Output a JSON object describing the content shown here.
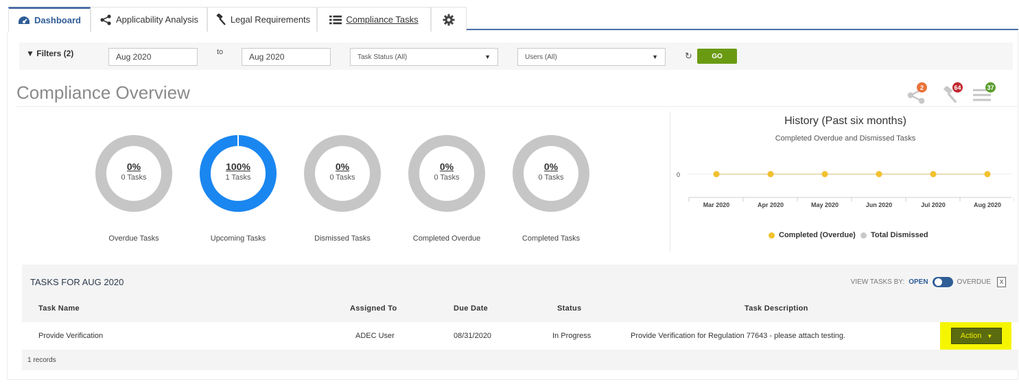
{
  "tabs": [
    {
      "label": "Dashboard",
      "icon": "dashboard-icon",
      "active": true
    },
    {
      "label": "Applicability Analysis",
      "icon": "share-icon"
    },
    {
      "label": "Legal Requirements",
      "icon": "gavel-icon"
    },
    {
      "label": "Compliance Tasks",
      "icon": "list-icon"
    },
    {
      "label": "",
      "icon": "gear-icon"
    }
  ],
  "filters": {
    "label": "Filters (2)",
    "from_value": "Aug 2020",
    "to_label": "to",
    "to_value": "Aug 2020",
    "status_select": "Task Status (All)",
    "users_select": "Users (All)",
    "go_label": "GO"
  },
  "overview": {
    "title": "Compliance Overview",
    "badges": [
      {
        "icon": "share-icon",
        "count": "2",
        "color": "#e8743b"
      },
      {
        "icon": "gavel-icon",
        "count": "64",
        "color": "#c0272d"
      },
      {
        "icon": "list-icon",
        "count": "37",
        "color": "#5a9e2f"
      }
    ]
  },
  "donuts": [
    {
      "pct": "0%",
      "tasks": "0 Tasks",
      "caption": "Overdue Tasks",
      "fill": 0
    },
    {
      "pct": "100%",
      "tasks": "1 Tasks",
      "caption": "Upcoming Tasks",
      "fill": 1
    },
    {
      "pct": "0%",
      "tasks": "0 Tasks",
      "caption": "Dismissed Tasks",
      "fill": 0
    },
    {
      "pct": "0%",
      "tasks": "0 Tasks",
      "caption": "Completed Overdue",
      "fill": 0
    },
    {
      "pct": "0%",
      "tasks": "0 Tasks",
      "caption": "Completed Tasks",
      "fill": 0
    }
  ],
  "chart_data": {
    "type": "line",
    "title": "History (Past six months)",
    "subtitle": "Completed Overdue and Dismissed Tasks",
    "categories": [
      "Mar 2020",
      "Apr 2020",
      "May 2020",
      "Jun 2020",
      "Jul 2020",
      "Aug 2020"
    ],
    "series": [
      {
        "name": "Completed (Overdue)",
        "values": [
          0,
          0,
          0,
          0,
          0,
          0
        ],
        "color": "#f2c12e"
      },
      {
        "name": "Total Dismissed",
        "values": [
          0,
          0,
          0,
          0,
          0,
          0
        ],
        "color": "#c8c8c8"
      }
    ],
    "yticks": [
      "0"
    ],
    "legend_position": "bottom"
  },
  "tasks": {
    "title": "TASKS FOR AUG 2020",
    "viewby_label": "VIEW TASKS BY:",
    "viewby_open": "OPEN",
    "viewby_overdue": "OVERDUE",
    "headers": [
      "Task Name",
      "Assigned To",
      "Due Date",
      "Status",
      "Task Description"
    ],
    "rows": [
      {
        "name": "Provide Verification",
        "assigned": "ADEC User",
        "due": "08/31/2020",
        "status": "In Progress",
        "description": "Provide Verification for Regulation 77643 - please attach testing.",
        "action_label": "Action"
      }
    ],
    "records": "1 records"
  },
  "colors": {
    "accent": "#4a6fa5",
    "go": "#6a9a12",
    "donut_full": "#1a86f0",
    "donut_empty": "#c6c6c6",
    "highlight": "#f5f500"
  }
}
